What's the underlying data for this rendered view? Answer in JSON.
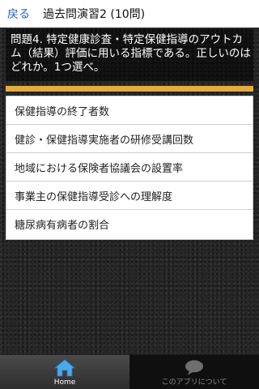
{
  "header": {
    "back_label": "戻る",
    "title": "過去問演習2 (10問)"
  },
  "question": {
    "text": "問題4. 特定健康診査・特定保健指導のアウトカム（結果）評価に用いる指標である。正しいのはどれか。1つ選べ。"
  },
  "answers": [
    {
      "label": "保健指導の終了者数"
    },
    {
      "label": "健診・保健指導実施者の研修受講回数"
    },
    {
      "label": "地域における保険者協議会の設置率"
    },
    {
      "label": "事業主の保健指導受診への理解度"
    },
    {
      "label": "糖尿病有病者の割合"
    }
  ],
  "bottom_nav": {
    "home_label": "Home",
    "home_icon": "home-icon",
    "about_label": "このアプリについて",
    "about_icon": "speech-bubble-icon"
  },
  "colors": {
    "accent": "#e6ac3a",
    "back_link": "#2b5fbf",
    "home_icon": "#4aa8e8"
  }
}
